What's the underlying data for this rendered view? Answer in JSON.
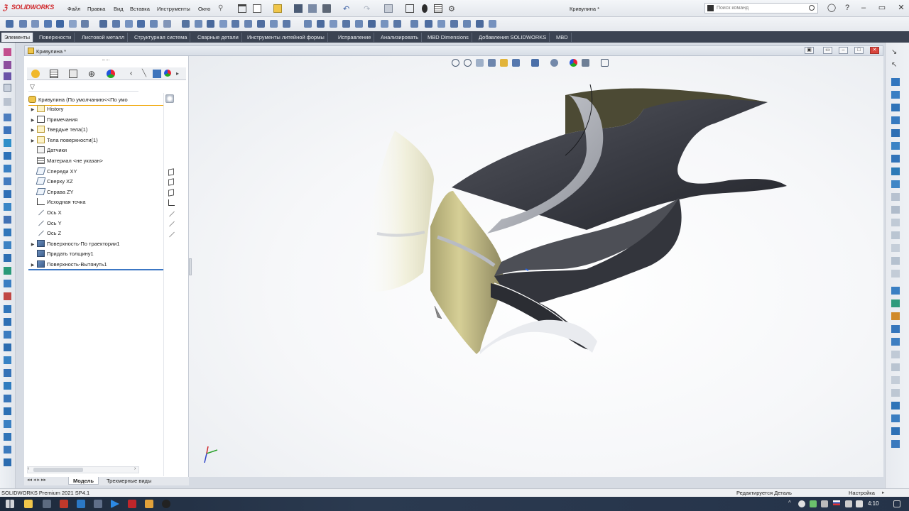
{
  "app": {
    "logo_text": "SOLIDWORKS",
    "window_title": "Кривулина *"
  },
  "menu": [
    "Файл",
    "Правка",
    "Вид",
    "Вставка",
    "Инструменты",
    "Окно"
  ],
  "search": {
    "placeholder": "Поиск команд"
  },
  "tabs": [
    {
      "label": "Элементы",
      "active": true
    },
    {
      "label": "Поверхности",
      "active": false
    },
    {
      "label": "Листовой металл",
      "active": false
    },
    {
      "label": "Структурная система",
      "active": false
    },
    {
      "label": "Сварные детали",
      "active": false
    },
    {
      "label": "Инструменты литейной формы",
      "active": false
    },
    {
      "label": "Исправление",
      "active": false
    },
    {
      "label": "Анализировать",
      "active": false
    },
    {
      "label": "MBD Dimensions",
      "active": false
    },
    {
      "label": "Добавления SOLIDWORKS",
      "active": false
    },
    {
      "label": "MBD",
      "active": false
    }
  ],
  "document": {
    "tab_title": "Кривулина *"
  },
  "feature_tree": {
    "root": "Кривулина  (По умолчанию<<По умо",
    "items": [
      {
        "label": "History",
        "icon": "folder-icon",
        "expandable": true
      },
      {
        "label": "Примечания",
        "icon": "annotations-icon",
        "expandable": true
      },
      {
        "label": "Твердые тела(1)",
        "icon": "solid-bodies-icon",
        "expandable": true
      },
      {
        "label": "Тела поверхности(1)",
        "icon": "surface-bodies-icon",
        "expandable": true
      },
      {
        "label": "Датчики",
        "icon": "sensor-icon",
        "expandable": false
      },
      {
        "label": "Материал <не указан>",
        "icon": "material-icon",
        "expandable": false
      },
      {
        "label": "Спереди XY",
        "icon": "plane-icon",
        "expandable": false
      },
      {
        "label": "Сверху XZ",
        "icon": "plane-icon",
        "expandable": false
      },
      {
        "label": "Справа ZY",
        "icon": "plane-icon",
        "expandable": false
      },
      {
        "label": "Исходная точка",
        "icon": "origin-icon",
        "expandable": false
      },
      {
        "label": "Ось X",
        "icon": "axis-icon",
        "expandable": false
      },
      {
        "label": "Ось Y",
        "icon": "axis-icon",
        "expandable": false
      },
      {
        "label": "Ось Z",
        "icon": "axis-icon",
        "expandable": false
      },
      {
        "label": "Поверхность-По траектории1",
        "icon": "sweep-surface-icon",
        "expandable": true
      },
      {
        "label": "Придать толщину1",
        "icon": "thicken-icon",
        "expandable": false
      },
      {
        "label": "Поверхность-Вытянуть1",
        "icon": "extrude-surface-icon",
        "expandable": true
      }
    ]
  },
  "bottom_tabs": [
    {
      "label": "Модель",
      "active": true
    },
    {
      "label": "Трехмерные виды",
      "active": false
    }
  ],
  "status": {
    "left": "SOLIDWORKS Premium 2021 SP4.1",
    "mid": "Редактируется Деталь",
    "right": "Настройка"
  },
  "taskbar": {
    "time": "4:10"
  },
  "colors": {
    "tab_bar_bg": "#3b4352",
    "model_khaki": "#c9c28a",
    "model_dark": "#2f3138",
    "model_gray": "#a9abb2",
    "selection_underline": "#3c77c4"
  }
}
